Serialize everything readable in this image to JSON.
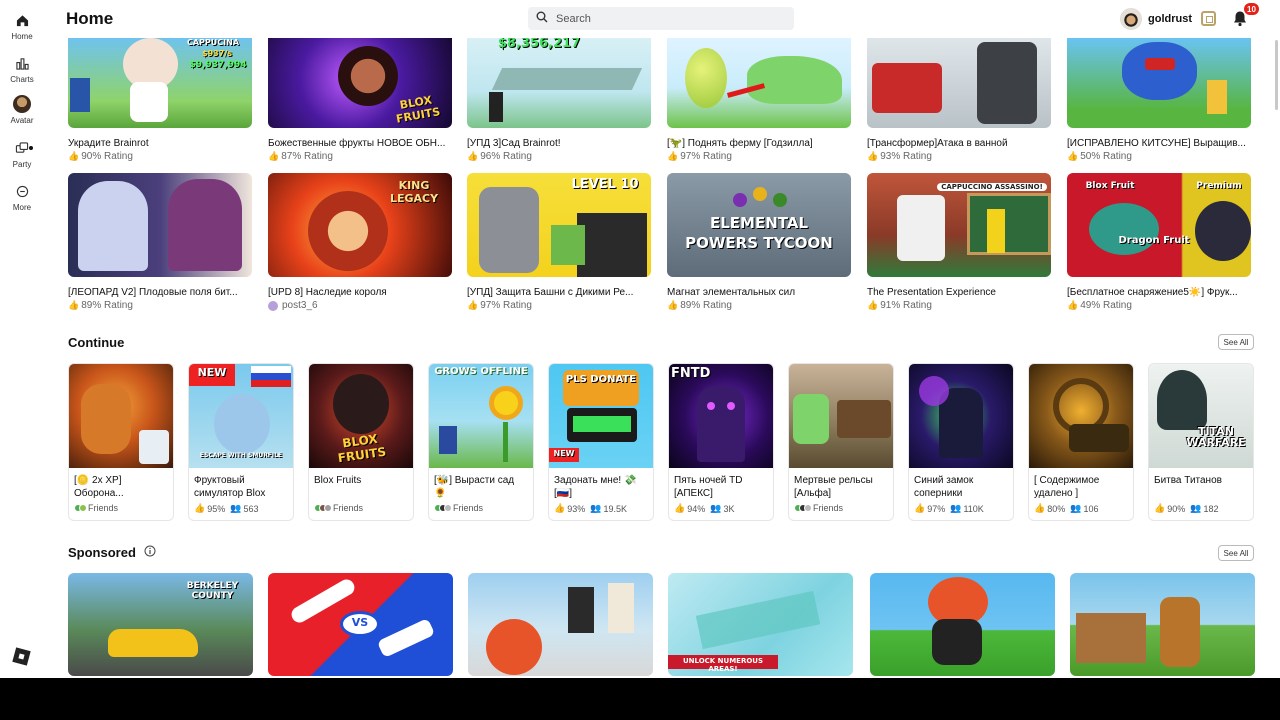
{
  "header": {
    "title": "Home",
    "search_placeholder": "Search",
    "username": "goldrust",
    "notification_count": "10"
  },
  "nav": {
    "items": [
      {
        "label": "Home",
        "icon": "home-icon"
      },
      {
        "label": "Charts",
        "icon": "charts-icon"
      },
      {
        "label": "Avatar",
        "icon": "avatar-icon"
      },
      {
        "label": "Party",
        "icon": "party-icon"
      },
      {
        "label": "More",
        "icon": "more-icon"
      }
    ]
  },
  "grid_row1": [
    {
      "name": "Украдите Brainrot",
      "meta": "90% Rating"
    },
    {
      "name": "Божественные фрукты НОВОЕ ОБН...",
      "meta": "87% Rating"
    },
    {
      "name": "[УПД 3]Сад Brainrot!",
      "meta": "96% Rating"
    },
    {
      "name": "[🦖] Поднять ферму [Годзилла]",
      "meta": "97% Rating"
    },
    {
      "name": "[Трансформер]Атака в ванной",
      "meta": "93% Rating"
    },
    {
      "name": "[ИСПРАВЛЕНО КИТСУНЕ] Выращив...",
      "meta": "50% Rating"
    }
  ],
  "grid_row2": [
    {
      "name": "[ЛЕОПАРД V2] Плодовые поля бит...",
      "meta": "89% Rating"
    },
    {
      "name": "[UPD 8] Наследие короля",
      "meta": "post3_6"
    },
    {
      "name": "[УПД] Защита Башни с Дикими Ре...",
      "meta": "97% Rating"
    },
    {
      "name": "Магнат элементальных сил",
      "meta": "89% Rating"
    },
    {
      "name": "The Presentation Experience",
      "meta": "91% Rating"
    },
    {
      "name": "[Бесплатное снаряжение5☀️] Фрук...",
      "meta": "49% Rating"
    }
  ],
  "thumb_text": {
    "cappucina": "CAPPUCINA",
    "money1": "$937/s",
    "money2": "$9,937,994",
    "money3": "$8,356,217",
    "blox": "BLOX FRUITS",
    "level": "LEVEL 10",
    "elemental": "ELEMENTAL POWERS TYCOON",
    "cappuccino": "CAPPUCCINO ASSASSINO!",
    "bloxfruit": "Blox Fruit",
    "premium": "Premium",
    "dragon": "Dragon Fruit",
    "king": "KING LEGACY",
    "new": "NEW",
    "grows": "GROWS OFFLINE",
    "pls": "PLS DONATE",
    "fntd": "FNTD",
    "titan": "TITAN WARFARE",
    "escape": "ESCAPE WITH SMURFILE",
    "berkeley": "BERKELEY COUNTY",
    "vs": "VS",
    "unlock": "UNLOCK NUMEROUS AREAS!"
  },
  "continue": {
    "title": "Continue",
    "see_all": "See All",
    "cards": [
      {
        "name": "[🪙 2x XP] Оборона...",
        "meta_type": "friends",
        "friends": "Friends"
      },
      {
        "name": "Фруктовый симулятор Blox",
        "meta_type": "stats",
        "rating": "95%",
        "players": "563"
      },
      {
        "name": "Blox Fruits",
        "meta_type": "friends",
        "friends": "Friends"
      },
      {
        "name": "[🐝] Вырасти сад 🌻",
        "meta_type": "friends",
        "friends": "Friends"
      },
      {
        "name": "Задонать мне! 💸 [🇷🇺]",
        "meta_type": "stats",
        "rating": "93%",
        "players": "19.5K"
      },
      {
        "name": "Пять ночей TD [АПЕКС]",
        "meta_type": "stats",
        "rating": "94%",
        "players": "3K"
      },
      {
        "name": "Мертвые рельсы [Альфа]",
        "meta_type": "friends",
        "friends": "Friends"
      },
      {
        "name": "Синий замок соперники",
        "meta_type": "stats",
        "rating": "97%",
        "players": "110K"
      },
      {
        "name": "[ Содержимое удалено ]",
        "meta_type": "stats",
        "rating": "80%",
        "players": "106"
      },
      {
        "name": "Битва Титанов",
        "meta_type": "stats",
        "rating": "90%",
        "players": "182"
      }
    ]
  },
  "sponsored": {
    "title": "Sponsored",
    "see_all": "See All"
  },
  "colors": {
    "badge": "#e2231a",
    "rating_text": "#666666",
    "see_all_border": "#bbbbbb"
  }
}
